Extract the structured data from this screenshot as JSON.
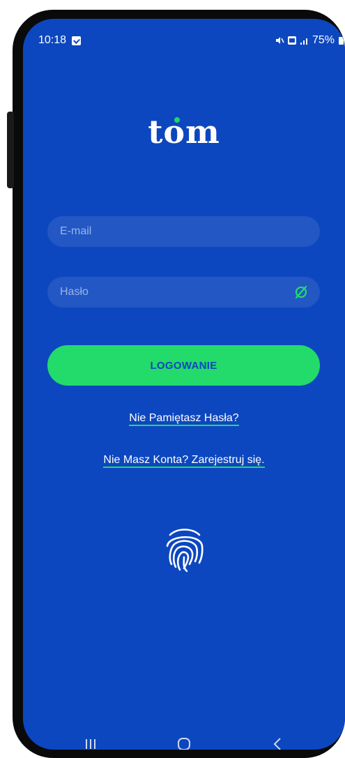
{
  "status_bar": {
    "time": "10:18",
    "battery": "75%"
  },
  "logo": {
    "text": "tom"
  },
  "form": {
    "email_placeholder": "E-mail",
    "password_placeholder": "Hasło",
    "login_button": "LOGOWANIE"
  },
  "links": {
    "forgot_password": "Nie Pamiętasz Hasła?",
    "register": "Nie Masz Konta? Zarejestruj się."
  },
  "colors": {
    "background": "#0d47bf",
    "accent": "#22db6b"
  },
  "icons": {
    "password_toggle": "eye-off-icon",
    "biometric": "fingerprint-icon"
  }
}
